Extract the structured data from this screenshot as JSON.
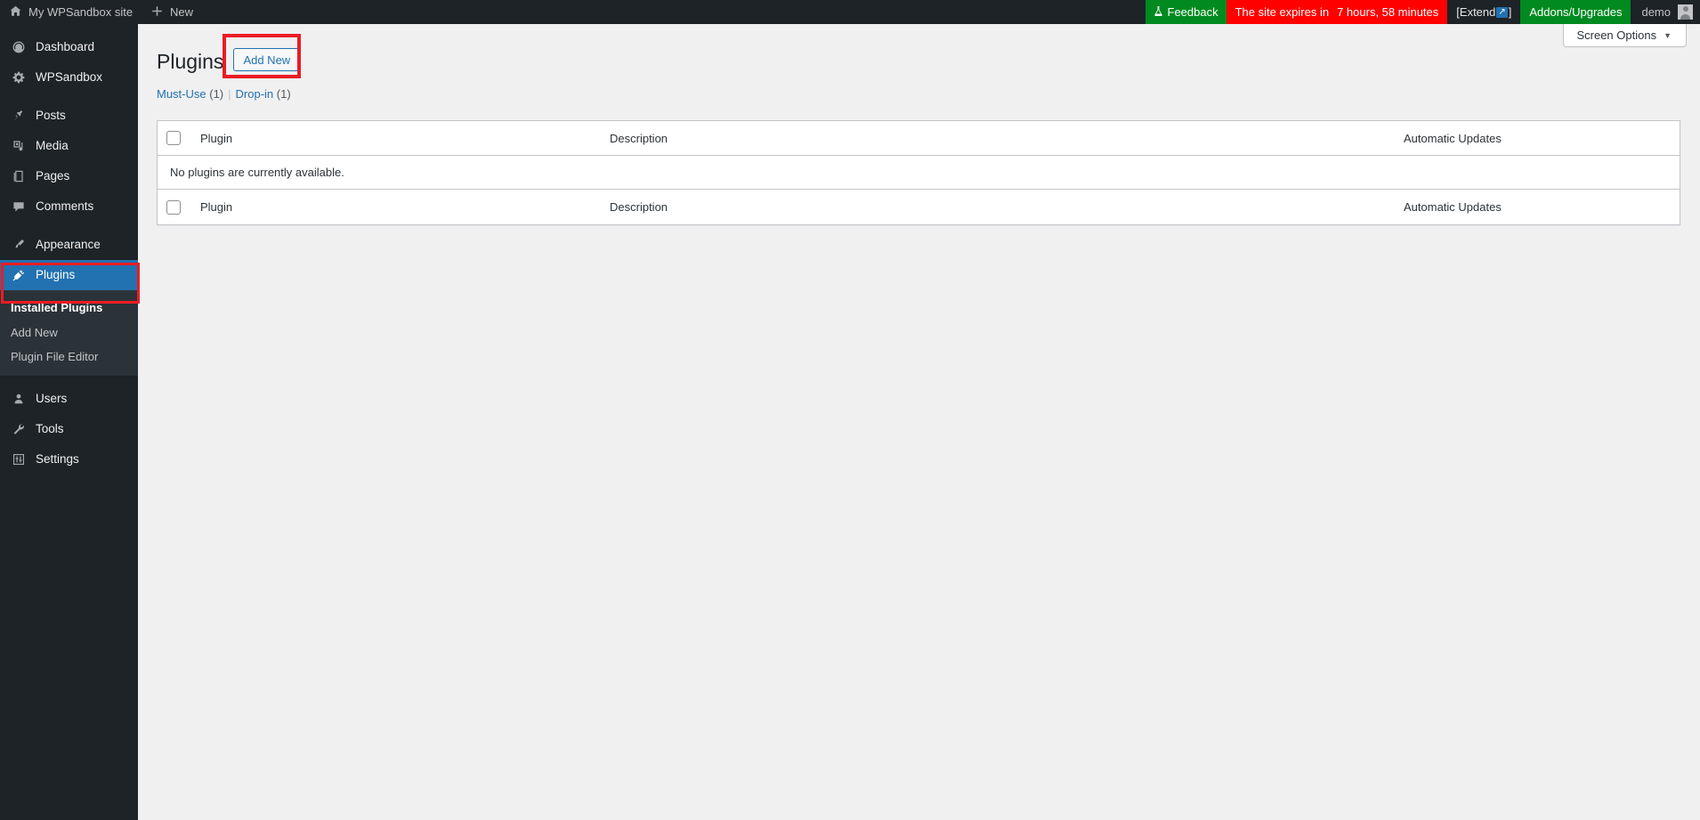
{
  "adminbar": {
    "site_icon": "home-icon",
    "site_name": "My WPSandbox site",
    "new_icon": "plus-icon",
    "new_label": "New",
    "feedback_icon": "flask-icon",
    "feedback_label": "Feedback",
    "expire_prefix": "The site expires in",
    "expire_value": "7 hours, 58 minutes",
    "extend_open": "[Extend",
    "extend_arrow": "↗",
    "extend_close": "]",
    "addons_label": "Addons/Upgrades",
    "user_label": "demo",
    "avatar": "user-avatar"
  },
  "colors": {
    "admin_bar_bg": "#1d2327",
    "sidebar_bg": "#1d2327",
    "submenu_bg": "#2c3338",
    "accent_blue": "#2271b1",
    "badge_green": "#008a20",
    "badge_red": "#ff0000",
    "highlight_red": "#ea1c24",
    "content_bg": "#f0f0f1"
  },
  "sidebar": {
    "items": [
      {
        "icon": "dashboard-icon",
        "label": "Dashboard",
        "current": false
      },
      {
        "icon": "gear-icon",
        "label": "WPSandbox",
        "current": false
      },
      {
        "icon": "pin-icon",
        "label": "Posts",
        "current": false
      },
      {
        "icon": "media-icon",
        "label": "Media",
        "current": false
      },
      {
        "icon": "pages-icon",
        "label": "Pages",
        "current": false
      },
      {
        "icon": "comment-icon",
        "label": "Comments",
        "current": false
      },
      {
        "icon": "brush-icon",
        "label": "Appearance",
        "current": false
      },
      {
        "icon": "plug-icon",
        "label": "Plugins",
        "current": true
      },
      {
        "icon": "user-icon",
        "label": "Users",
        "current": false
      },
      {
        "icon": "wrench-icon",
        "label": "Tools",
        "current": false
      },
      {
        "icon": "settings-icon",
        "label": "Settings",
        "current": false
      }
    ],
    "submenu": [
      {
        "label": "Installed Plugins",
        "current": true
      },
      {
        "label": "Add New",
        "current": false
      },
      {
        "label": "Plugin File Editor",
        "current": false
      }
    ]
  },
  "screen_meta": {
    "screen_options_label": "Screen Options",
    "caret": "▼"
  },
  "page": {
    "title": "Plugins",
    "add_new_label": "Add New",
    "filters": [
      {
        "label": "Must-Use",
        "count": "(1)"
      },
      {
        "label": "Drop-in",
        "count": "(1)"
      }
    ],
    "filter_divider": "|"
  },
  "table": {
    "columns": {
      "plugin": "Plugin",
      "description": "Description",
      "automatic_updates": "Automatic Updates"
    },
    "empty_message": "No plugins are currently available.",
    "select_all_checkbox": "unchecked"
  }
}
